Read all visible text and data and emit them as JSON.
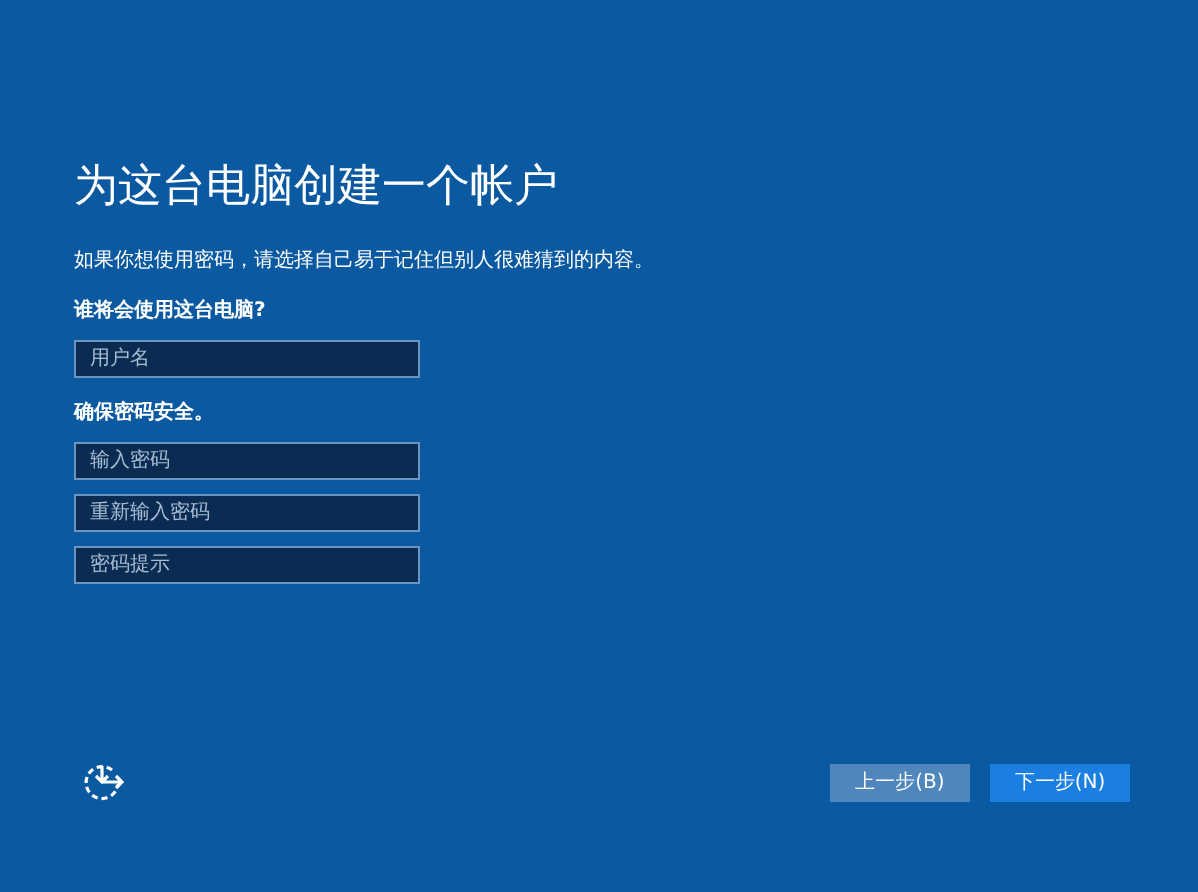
{
  "title": "为这台电脑创建一个帐户",
  "intro": "如果你想使用密码，请选择自己易于记住但别人很难猜到的内容。",
  "sections": [
    {
      "label": "谁将会使用这台电脑?",
      "fields": [
        {
          "placeholder": "用户名"
        }
      ]
    },
    {
      "label": "确保密码安全。",
      "fields": [
        {
          "placeholder": "输入密码"
        },
        {
          "placeholder": "重新输入密码"
        },
        {
          "placeholder": "密码提示"
        }
      ]
    }
  ],
  "buttons": [
    {
      "label": "上一步(B)",
      "kind": "secondary"
    },
    {
      "label": "下一步(N)",
      "kind": "primary"
    }
  ]
}
